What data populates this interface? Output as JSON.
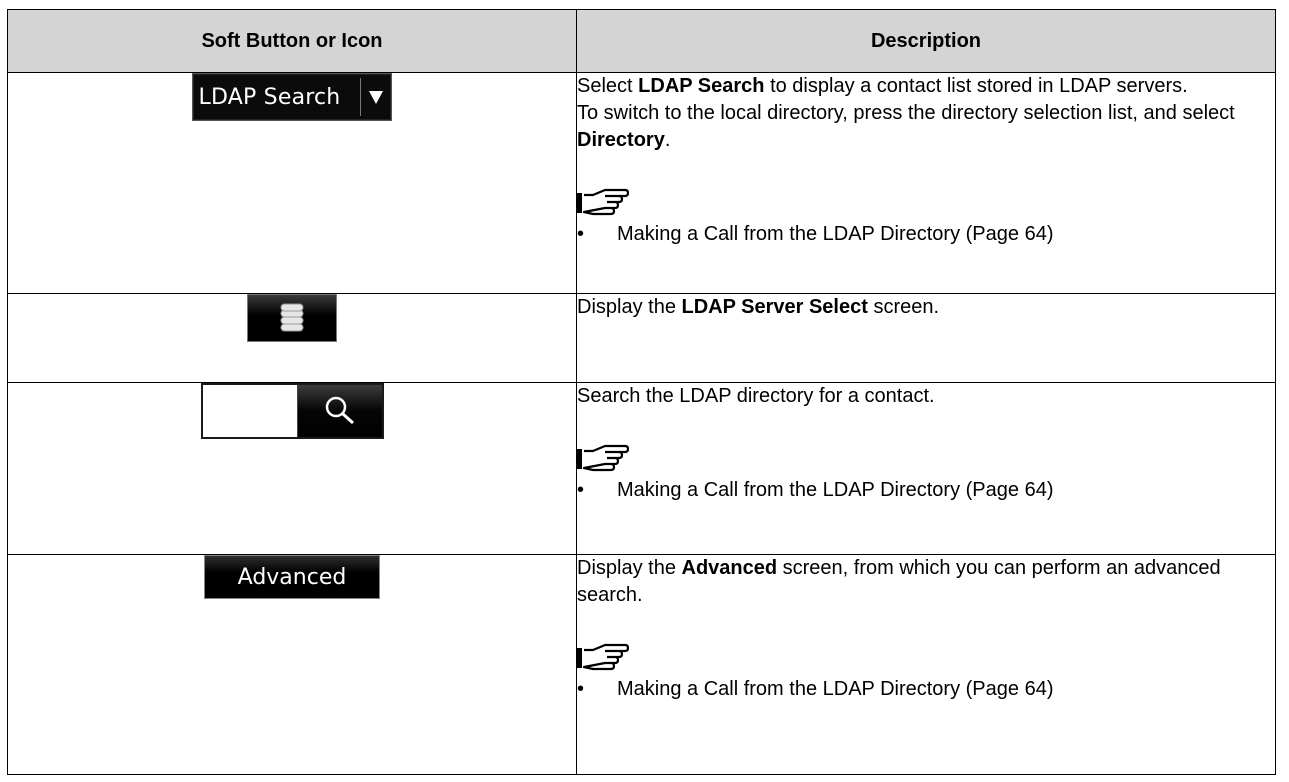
{
  "table": {
    "headers": [
      "Soft Button or Icon",
      "Description"
    ],
    "rows": [
      {
        "button": {
          "type": "dropdown",
          "label": "LDAP Search",
          "icon": "dropdown-arrow-icon"
        },
        "desc": {
          "p1_pre": "Select ",
          "p1_bold": "LDAP Search",
          "p1_post": " to display a contact list stored in LDAP servers.",
          "p2_pre": "To switch to the local directory, press the directory selection list, and select ",
          "p2_bold": "Directory",
          "p2_post": ".",
          "note_icon": "pointing-hand-icon",
          "bullet": "Making a Call from the LDAP Directory (Page 64)"
        }
      },
      {
        "button": {
          "type": "icon",
          "icon": "database-icon"
        },
        "desc": {
          "p1_pre": "Display the ",
          "p1_bold": "LDAP Server Select",
          "p1_post": " screen."
        }
      },
      {
        "button": {
          "type": "search",
          "icon": "magnifier-icon"
        },
        "desc": {
          "p1": "Search the LDAP directory for a contact.",
          "note_icon": "pointing-hand-icon",
          "bullet": "Making a Call from the LDAP Directory (Page 64)"
        }
      },
      {
        "button": {
          "type": "button",
          "label": "Advanced"
        },
        "desc": {
          "p1_pre": "Display the ",
          "p1_bold": "Advanced",
          "p1_post": " screen, from which you can perform an advanced search.",
          "note_icon": "pointing-hand-icon",
          "bullet": "Making a Call from the LDAP Directory (Page 64)"
        }
      }
    ]
  }
}
